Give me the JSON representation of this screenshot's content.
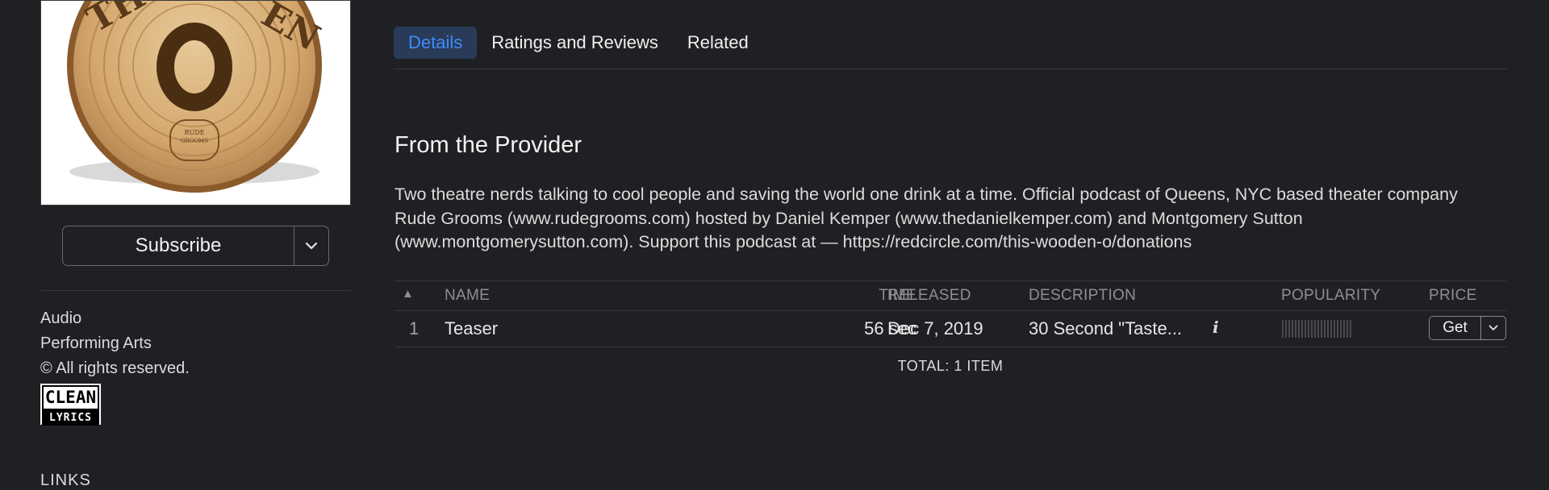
{
  "sidebar": {
    "subscribe_label": "Subscribe",
    "meta": [
      "Audio",
      "Performing Arts",
      "© All rights reserved."
    ],
    "badge": {
      "top": "CLEAN",
      "bottom": "LYRICS"
    },
    "links_heading": "LINKS"
  },
  "tabs": [
    {
      "label": "Details",
      "active": true
    },
    {
      "label": "Ratings and Reviews",
      "active": false
    },
    {
      "label": "Related",
      "active": false
    }
  ],
  "provider": {
    "title": "From the Provider",
    "description": "Two theatre nerds talking to cool people and saving the world one drink at a time. Official podcast of Queens, NYC based theater company Rude Grooms (www.rudegrooms.com) hosted by Daniel Kemper (www.thedanielkemper.com) and Montgomery Sutton (www.montgomerysutton.com). Support this podcast at — https://redcircle.com/this-wooden-o/donations"
  },
  "table": {
    "headers": {
      "sort": "▲",
      "name": "NAME",
      "time": "TIME",
      "released": "RELEASED",
      "description": "DESCRIPTION",
      "popularity": "POPULARITY",
      "price": "PRICE"
    },
    "rows": [
      {
        "index": "1",
        "name": "Teaser",
        "time": "56 sec",
        "released": "Dec 7, 2019",
        "description": "30 Second \"Taste...",
        "info_icon": "i",
        "price_label": "Get"
      }
    ],
    "total": "TOTAL: 1 ITEM"
  },
  "colors": {
    "background": "#1f2023",
    "accent": "#3d8bff",
    "active_tab_bg": "#2a3b57"
  },
  "icons": [
    "chevron-down-icon",
    "sort-ascending-icon",
    "info-icon",
    "popularity-meter"
  ]
}
